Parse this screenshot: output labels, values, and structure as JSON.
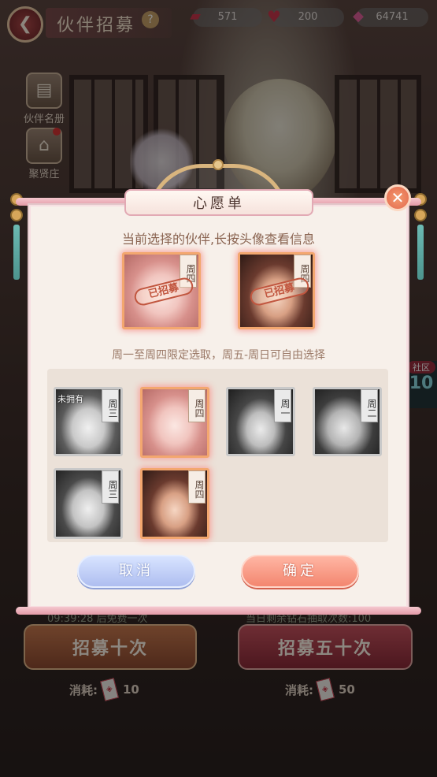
{
  "header": {
    "back_icon": "back-arrow-icon",
    "title": "伙伴招募",
    "help_glyph": "?",
    "resources": [
      {
        "icon": "ticket-icon",
        "value": "571"
      },
      {
        "icon": "heart-icon",
        "value": "200"
      },
      {
        "icon": "gem-icon",
        "value": "64741"
      }
    ]
  },
  "sidebar": {
    "items": [
      {
        "label": "伙伴名册",
        "icon": "book-icon"
      },
      {
        "label": "聚贤庄",
        "icon": "pavilion-icon"
      }
    ]
  },
  "community_tab": {
    "label": "社区",
    "value": "10"
  },
  "recruit": {
    "timer_text": "09:39:28 后免费一次",
    "quota_text": "当日剩余钻石抽取次数:100",
    "btn_10": "招募十次",
    "btn_50": "招募五十次",
    "cost_label": "消耗:",
    "cost_10": "10",
    "cost_50": "50"
  },
  "wishlist": {
    "title": "心愿单",
    "hint_selected": "当前选择的伙伴,长按头像查看信息",
    "hint_rule": "周一至周四限定选取，周五-周日可自由选择",
    "selected": [
      {
        "day": "周四",
        "stamp": "已招募"
      },
      {
        "day": "周四",
        "stamp": "已招募"
      }
    ],
    "candidates": [
      {
        "day": "周三",
        "note": "未拥有"
      },
      {
        "day": "周四"
      },
      {
        "day": "周一"
      },
      {
        "day": "周二"
      },
      {
        "day": "周三"
      },
      {
        "day": "周四"
      }
    ],
    "cancel_label": "取消",
    "confirm_label": "确定",
    "close_glyph": "✕"
  }
}
